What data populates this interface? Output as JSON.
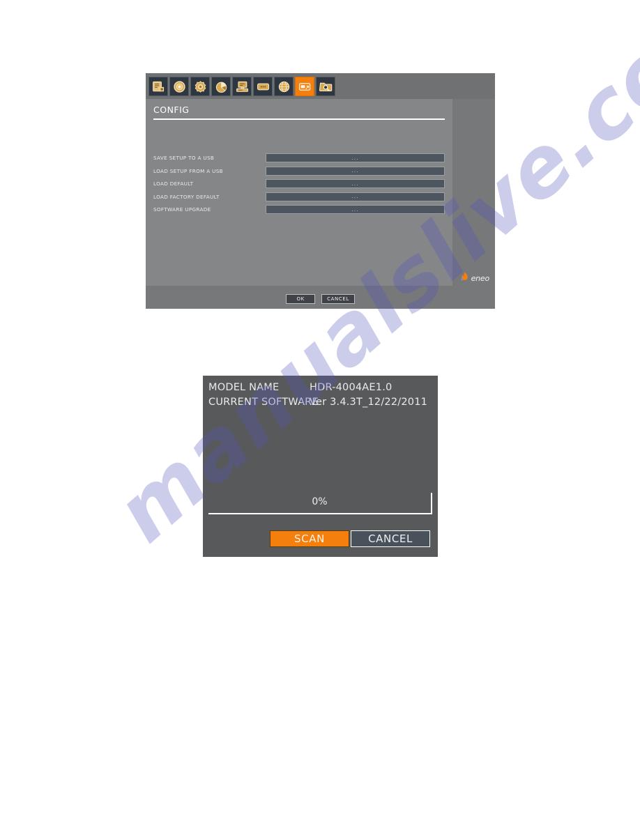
{
  "config_window": {
    "tabs": [
      {
        "name": "system-tab",
        "icon": "document-settings-icon",
        "active": false
      },
      {
        "name": "record-tab",
        "icon": "record-disc-icon",
        "active": false
      },
      {
        "name": "device-tab",
        "icon": "gear-camera-icon",
        "active": false
      },
      {
        "name": "disk-tab",
        "icon": "pie-chart-disk-icon",
        "active": false
      },
      {
        "name": "display-tab",
        "icon": "monitor-icon",
        "active": false
      },
      {
        "name": "event-tab",
        "icon": "card-icon",
        "active": false
      },
      {
        "name": "network-tab",
        "icon": "globe-icon",
        "active": false
      },
      {
        "name": "config-tab",
        "icon": "config-export-icon",
        "active": true
      },
      {
        "name": "search-tab",
        "icon": "folder-search-icon",
        "active": false
      }
    ],
    "title": "CONFIG",
    "rows": [
      {
        "label": "SAVE SETUP TO A USB",
        "value": "..."
      },
      {
        "label": "LOAD SETUP FROM A USB",
        "value": "..."
      },
      {
        "label": "LOAD DEFAULT",
        "value": "..."
      },
      {
        "label": "LOAD FACTORY DEFAULT",
        "value": "..."
      },
      {
        "label": "SOFTWARE UPGRADE",
        "value": "..."
      }
    ],
    "brand": "eneo",
    "footer": {
      "ok_label": "OK",
      "cancel_label": "CANCEL"
    }
  },
  "upgrade_dialog": {
    "model_name_label": "MODEL NAME",
    "model_name_value": "HDR-4004AE1.0",
    "current_software_label": "CURRENT SOFTWARE",
    "current_software_value": "Ver 3.4.3T_12/22/2011",
    "progress_text": "0%",
    "progress_percent": 0,
    "scan_label": "SCAN",
    "cancel_label": "CANCEL"
  },
  "watermark": {
    "text": "manualslive.com"
  },
  "colors": {
    "accent_orange": "#f57f0c",
    "window_gray": "#76787a",
    "panel_gray": "#848688",
    "dialog_gray": "#58595a",
    "field_slate": "#4d565e",
    "tab_dark": "#2e3640"
  }
}
